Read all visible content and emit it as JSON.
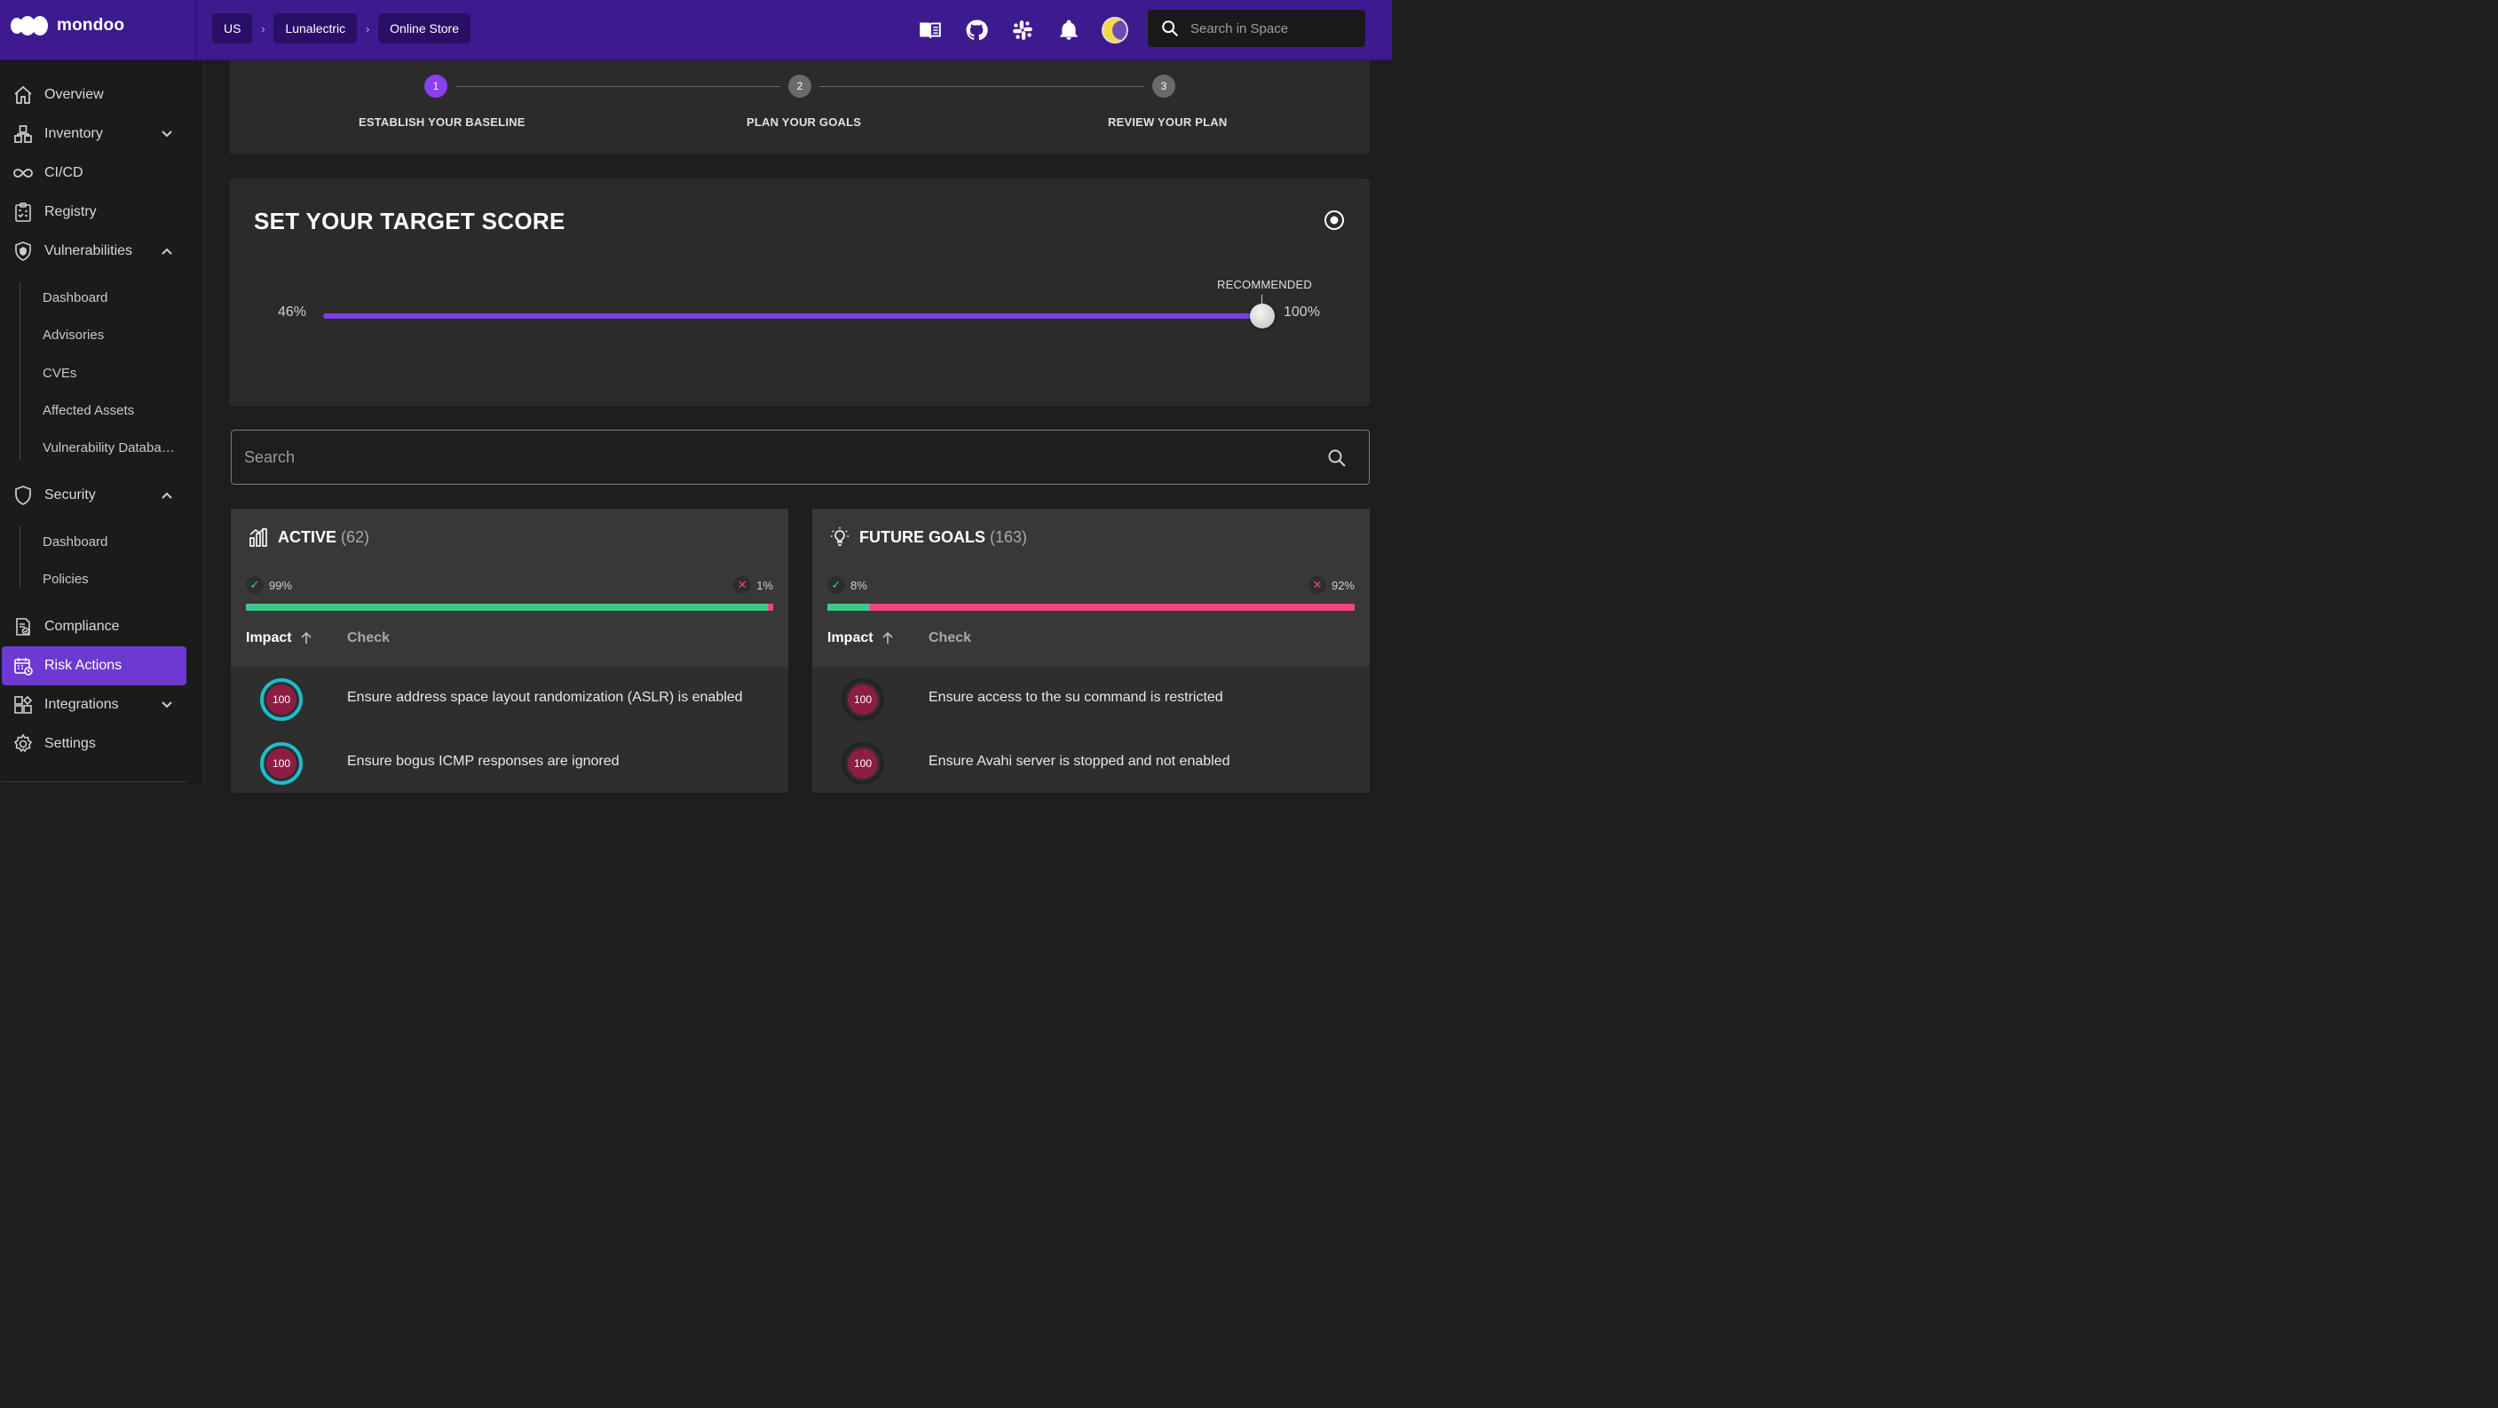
{
  "app": {
    "logo_text": "mondoo"
  },
  "breadcrumbs": [
    {
      "label": "US"
    },
    {
      "label": "Lunalectric"
    },
    {
      "label": "Online Store"
    }
  ],
  "breadcrumb_sep": "›",
  "topbar": {
    "icons": [
      "docs-book-icon",
      "github-icon",
      "slack-icon",
      "bell-icon",
      "theme-toggle-icon"
    ],
    "search_placeholder": "Search in Space"
  },
  "sidebar": {
    "items": [
      {
        "label": "Overview",
        "icon": "home-icon"
      },
      {
        "label": "Inventory",
        "icon": "inventory-icon",
        "expanded": false
      },
      {
        "label": "CI/CD",
        "icon": "infinity-icon"
      },
      {
        "label": "Registry",
        "icon": "registry-icon"
      },
      {
        "label": "Vulnerabilities",
        "icon": "shield-bug-icon",
        "expanded": true
      },
      {
        "label": "Security",
        "icon": "shield-icon",
        "expanded": true
      },
      {
        "label": "Compliance",
        "icon": "compliance-icon"
      },
      {
        "label": "Risk Actions",
        "icon": "calendar-icon",
        "active": true
      },
      {
        "label": "Integrations",
        "icon": "integrations-icon",
        "expanded": false
      },
      {
        "label": "Settings",
        "icon": "gear-icon"
      }
    ],
    "vuln_sub": [
      "Dashboard",
      "Advisories",
      "CVEs",
      "Affected Assets",
      "Vulnerability Databa…"
    ],
    "security_sub": [
      "Dashboard",
      "Policies"
    ]
  },
  "stepper": {
    "steps": [
      {
        "number": "1",
        "label": "ESTABLISH YOUR BASELINE",
        "state": "active"
      },
      {
        "number": "2",
        "label": "PLAN YOUR GOALS",
        "state": "pending"
      },
      {
        "number": "3",
        "label": "REVIEW YOUR PLAN",
        "state": "pending"
      }
    ]
  },
  "target": {
    "title": "SET YOUR TARGET SCORE",
    "min_label": "46%",
    "max_label": "100%",
    "recommended_label": "RECOMMENDED",
    "value": 100
  },
  "search": {
    "placeholder": "Search"
  },
  "active_panel": {
    "title": "ACTIVE",
    "count": "(62)",
    "pass_pct": "99%",
    "fail_pct": "1%",
    "pass_fraction": 0.99,
    "col_impact": "Impact",
    "col_check": "Check",
    "rows": [
      {
        "impact": "100",
        "check": "Ensure address space layout randomization (ASLR) is enabled"
      },
      {
        "impact": "100",
        "check": "Ensure bogus ICMP responses are ignored"
      }
    ]
  },
  "future_panel": {
    "title": "FUTURE GOALS",
    "count": "(163)",
    "pass_pct": "8%",
    "fail_pct": "92%",
    "pass_fraction": 0.08,
    "col_impact": "Impact",
    "col_check": "Check",
    "rows": [
      {
        "impact": "100",
        "check": "Ensure access to the su command is restricted"
      },
      {
        "impact": "100",
        "check": "Ensure Avahi server is stopped and not enabled"
      }
    ]
  },
  "colors": {
    "topbar": "#3e1a8f",
    "accent": "#7b3fe4",
    "pass": "#39c98a",
    "fail": "#f0457a",
    "impact_ring": "#1bbfcf",
    "impact_fill": "#8c1d44"
  }
}
